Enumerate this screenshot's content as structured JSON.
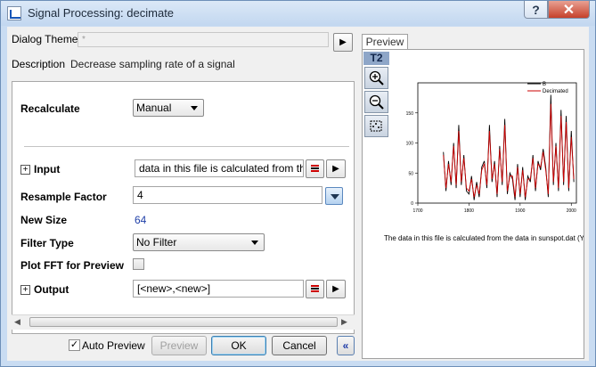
{
  "window": {
    "title": "Signal Processing: decimate",
    "help_label": "?",
    "close_label": "✕"
  },
  "dialog": {
    "theme_label": "Dialog Theme",
    "theme_value": "*",
    "description_label": "Description",
    "description_value": "Decrease sampling rate of a signal"
  },
  "params": {
    "recalculate_label": "Recalculate",
    "recalculate_value": "Manual",
    "input_label": "Input",
    "input_value": "data in this file is calculated from the da",
    "resample_label": "Resample Factor",
    "resample_value": "4",
    "newsize_label": "New Size",
    "newsize_value": "64",
    "filter_label": "Filter Type",
    "filter_value": "No Filter",
    "plotfft_label": "Plot FFT for Preview",
    "plotfft_checked": false,
    "output_label": "Output",
    "output_value": "[<new>,<new>]"
  },
  "footer": {
    "auto_preview_label": "Auto Preview",
    "auto_preview_checked": true,
    "preview_label": "Preview",
    "ok_label": "OK",
    "cancel_label": "Cancel",
    "collapse_label": "«"
  },
  "preview": {
    "tab_label": "Preview",
    "toolbar_badge": "T2",
    "caption": "The data in this file is calculated from the data in sunspot.dat (Ye"
  },
  "chart_data": {
    "type": "line",
    "xlim": [
      1700,
      2010
    ],
    "ylim": [
      0,
      200
    ],
    "x_ticks": [
      "1700",
      "1800",
      "1900",
      "2000"
    ],
    "y_ticks": [
      "0",
      "50",
      "100",
      "150"
    ],
    "series": [
      {
        "name": "B",
        "color": "#000000",
        "x": [
          1750,
          1755,
          1760,
          1765,
          1770,
          1775,
          1780,
          1785,
          1790,
          1795,
          1800,
          1805,
          1810,
          1815,
          1820,
          1825,
          1830,
          1835,
          1840,
          1845,
          1850,
          1855,
          1860,
          1865,
          1870,
          1875,
          1880,
          1885,
          1890,
          1895,
          1900,
          1905,
          1910,
          1915,
          1920,
          1925,
          1930,
          1935,
          1940,
          1945,
          1950,
          1955,
          1960,
          1965,
          1970,
          1975,
          1980,
          1985,
          1990,
          1995,
          2000,
          2005
        ],
        "values": [
          85,
          20,
          70,
          30,
          100,
          25,
          130,
          30,
          80,
          20,
          15,
          45,
          5,
          35,
          10,
          60,
          70,
          25,
          130,
          35,
          70,
          10,
          95,
          30,
          140,
          15,
          50,
          40,
          5,
          65,
          10,
          60,
          5,
          45,
          35,
          80,
          20,
          70,
          55,
          90,
          60,
          10,
          180,
          30,
          100,
          20,
          155,
          30,
          145,
          20,
          120,
          35
        ]
      },
      {
        "name": "Decimated",
        "color": "#cc0000",
        "x": [
          1750,
          1755,
          1760,
          1765,
          1770,
          1775,
          1780,
          1785,
          1790,
          1795,
          1800,
          1805,
          1810,
          1815,
          1820,
          1825,
          1830,
          1835,
          1840,
          1845,
          1850,
          1855,
          1860,
          1865,
          1870,
          1875,
          1880,
          1885,
          1890,
          1895,
          1900,
          1905,
          1910,
          1915,
          1920,
          1925,
          1930,
          1935,
          1940,
          1945,
          1950,
          1955,
          1960,
          1965,
          1970,
          1975,
          1980,
          1985,
          1990,
          1995,
          2000,
          2005
        ],
        "values": [
          80,
          25,
          65,
          35,
          95,
          30,
          120,
          35,
          75,
          25,
          20,
          40,
          10,
          30,
          15,
          55,
          65,
          30,
          120,
          40,
          65,
          15,
          90,
          35,
          130,
          20,
          45,
          45,
          10,
          60,
          15,
          55,
          10,
          40,
          40,
          75,
          25,
          65,
          60,
          85,
          55,
          15,
          165,
          35,
          95,
          25,
          145,
          35,
          135,
          25,
          110,
          40
        ]
      }
    ]
  }
}
